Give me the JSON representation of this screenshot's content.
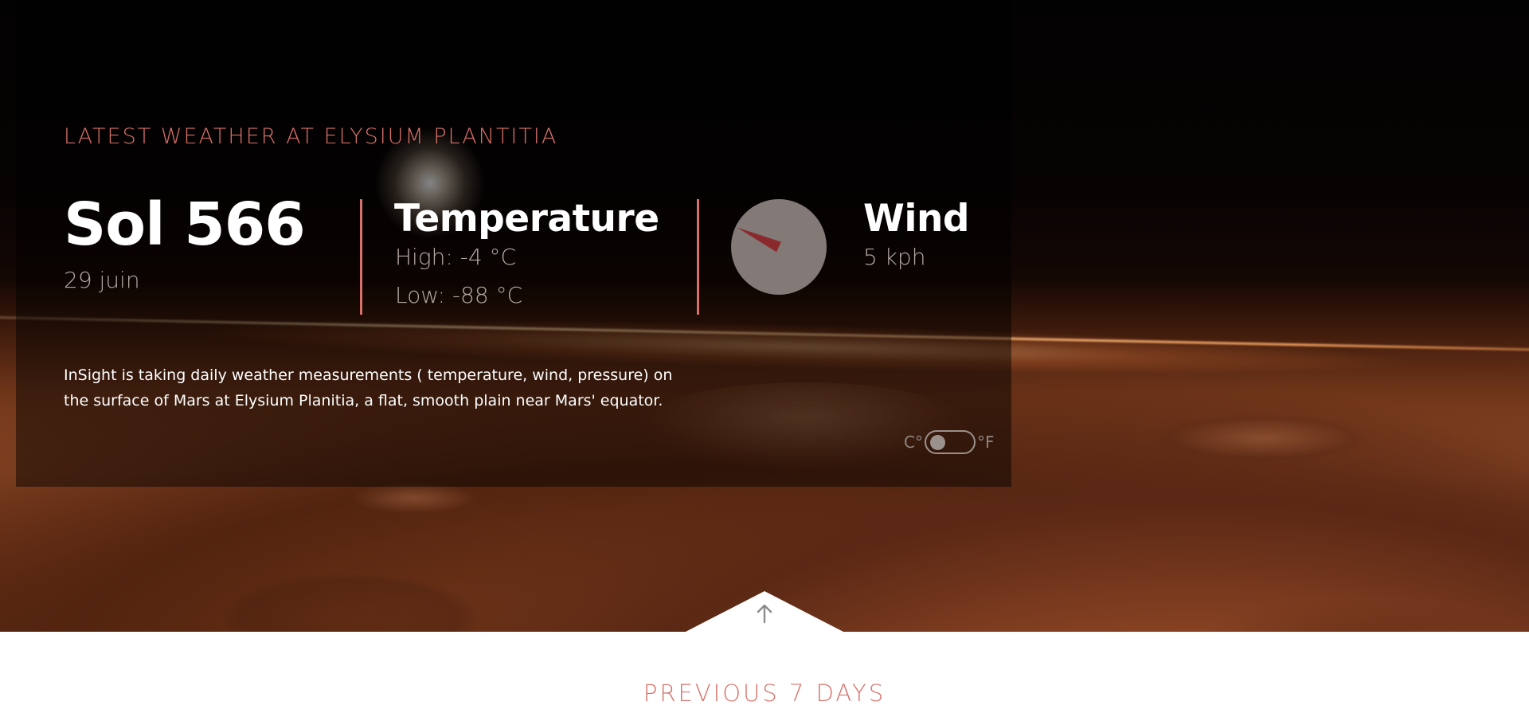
{
  "current": {
    "heading": "LATEST WEATHER AT ELYSIUM PLANTITIA",
    "sol": "Sol 566",
    "date": "29 juin",
    "temperature": {
      "label": "Temperature",
      "high": "High: -4 °C",
      "low": "Low: -88 °C"
    },
    "wind": {
      "label": "Wind",
      "speed": "5 kph",
      "direction_degrees": 295
    },
    "description": "InSight is taking daily weather measurements ( temperature, wind, pressure) on the surface of Mars at Elysium Planitia, a flat, smooth plain near Mars' equator."
  },
  "unit_toggle": {
    "celsius_label": "C°",
    "fahrenheit_label": "°F",
    "selected": "C"
  },
  "previous": {
    "heading": "PREVIOUS 7 DAYS"
  },
  "icons": {
    "toggle_arrow": "arrow-up-icon",
    "wind_direction": "compass-icon"
  },
  "colors": {
    "accent": "#d7716a",
    "wind_arrow": "#8b2a2e",
    "muted_text": "#b5a9a3"
  }
}
